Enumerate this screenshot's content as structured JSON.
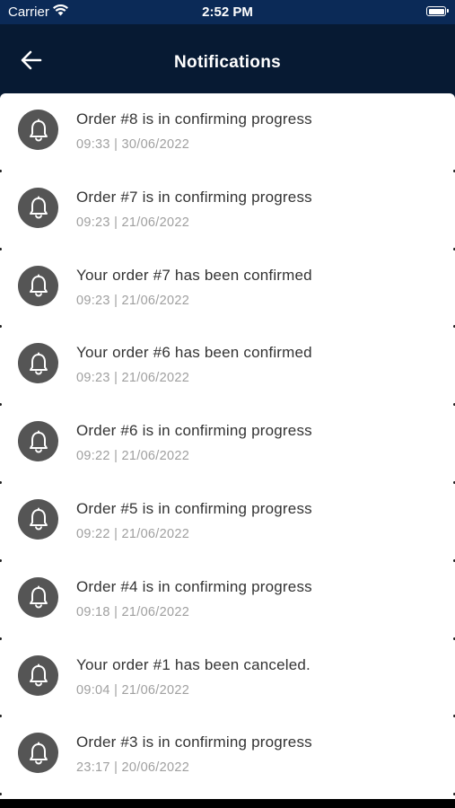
{
  "status_bar": {
    "carrier": "Carrier",
    "time": "2:52 PM",
    "icons": [
      "wifi-icon",
      "battery-icon"
    ]
  },
  "header": {
    "title": "Notifications",
    "back_icon": "arrow-left-icon"
  },
  "notifications": [
    {
      "title": "Order #8 is in confirming progress",
      "time": "09:33 | 30/06/2022",
      "icon": "bell-icon"
    },
    {
      "title": "Order #7 is in confirming progress",
      "time": "09:23 | 21/06/2022",
      "icon": "bell-icon"
    },
    {
      "title": "Your order #7 has been confirmed",
      "time": "09:23 | 21/06/2022",
      "icon": "bell-icon"
    },
    {
      "title": "Your order #6 has been confirmed",
      "time": "09:23 | 21/06/2022",
      "icon": "bell-icon"
    },
    {
      "title": "Order #6 is in confirming progress",
      "time": "09:22 | 21/06/2022",
      "icon": "bell-icon"
    },
    {
      "title": "Order #5 is in confirming progress",
      "time": "09:22 | 21/06/2022",
      "icon": "bell-icon"
    },
    {
      "title": "Order #4 is in confirming progress",
      "time": "09:18 | 21/06/2022",
      "icon": "bell-icon"
    },
    {
      "title": "Your order #1 has been canceled.",
      "time": "09:04 | 21/06/2022",
      "icon": "bell-icon"
    },
    {
      "title": "Order #3 is in confirming progress",
      "time": "23:17 | 20/06/2022",
      "icon": "bell-icon"
    }
  ],
  "colors": {
    "status_bar_bg": "#0b2a57",
    "header_bg": "#071a33",
    "avatar_bg": "#555555",
    "title_text": "#333333",
    "time_text": "#a0a0a0"
  }
}
